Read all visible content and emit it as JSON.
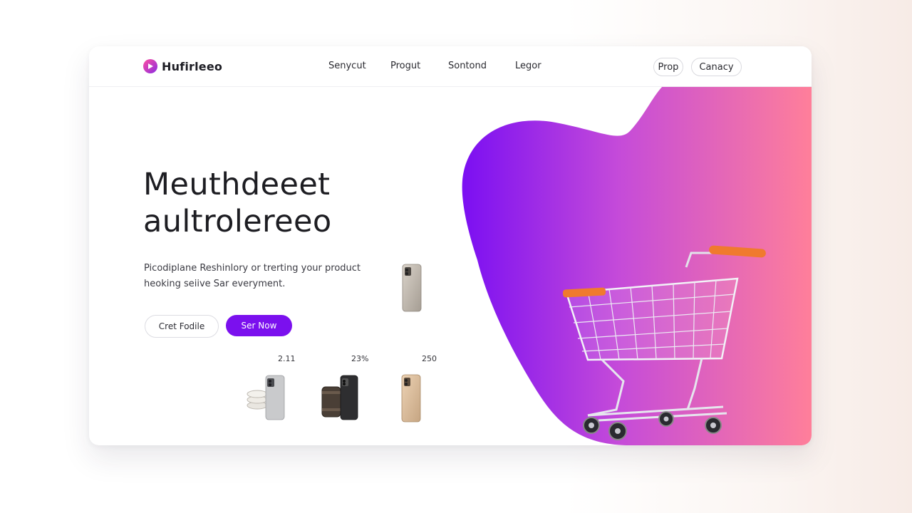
{
  "brand": {
    "name": "Hufirleeo"
  },
  "nav": {
    "items": [
      "Senycut",
      "Progut",
      "Sontond",
      "Legor"
    ]
  },
  "header_actions": {
    "primary_pill": "Prop",
    "secondary_pill": "Canacy"
  },
  "hero": {
    "title_line1": "Meuthdeeet",
    "title_line2": "aultrolereeo",
    "desc_line1": "Picodiplane Reshinlory or trerting your product",
    "desc_line2": "heoking seiive Sar everyment.",
    "cta_secondary": "Cret Fodile",
    "cta_primary": "Ser Now"
  },
  "products": [
    {
      "price": "2.11",
      "icon": "phone-stack-icon"
    },
    {
      "price": "23%",
      "icon": "phone-with-canister-icon"
    },
    {
      "price": "250",
      "icon": "gold-phone-icon"
    }
  ],
  "colors": {
    "accent": "#7b10ee",
    "gradient_start": "#7b0ff2",
    "gradient_end": "#ff7f9a",
    "text_primary": "#1d1d22"
  }
}
